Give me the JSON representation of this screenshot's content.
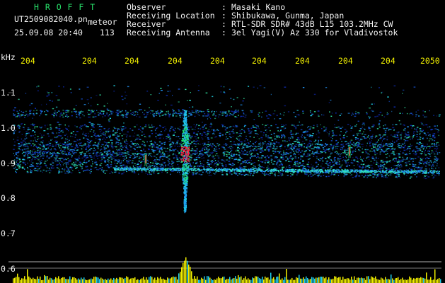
{
  "header": {
    "logo": "H R O F F T",
    "filename": "UT2509082040.pn",
    "mode_label": "meteor",
    "datetime": "25.09.08 20:40",
    "count": "113",
    "fields": [
      {
        "label": "Observer",
        "sep": ":",
        "value": "Masaki Kano"
      },
      {
        "label": "Receiving Location",
        "sep": ":",
        "value": "Shibukawa, Gunma, Japan"
      },
      {
        "label": "Receiver",
        "sep": ":",
        "value": "RTL-SDR SDR# 43dB L15 103.2MHz CW"
      },
      {
        "label": "Receiving Antenna",
        "sep": ":",
        "value": "3el Yagi(V) Az 330 for Vladivostok"
      }
    ]
  },
  "spectrogram": {
    "freq_unit": "kHz",
    "freq_ticks": [
      "1.1",
      "1.0",
      "0.9",
      "0.8",
      "0.7",
      "0.6"
    ],
    "time_ticks": [
      "204",
      "204",
      "204",
      "204",
      "204",
      "204",
      "204",
      "204",
      "204",
      "2050"
    ],
    "colors": {
      "background": "#000000",
      "text": "#f2f2f2",
      "logo": "#27e06a",
      "axis_labels": "#f2f000",
      "signal_low": "#1030c0",
      "signal_mid": "#20d0e0",
      "signal_high": "#ff2040"
    }
  }
}
